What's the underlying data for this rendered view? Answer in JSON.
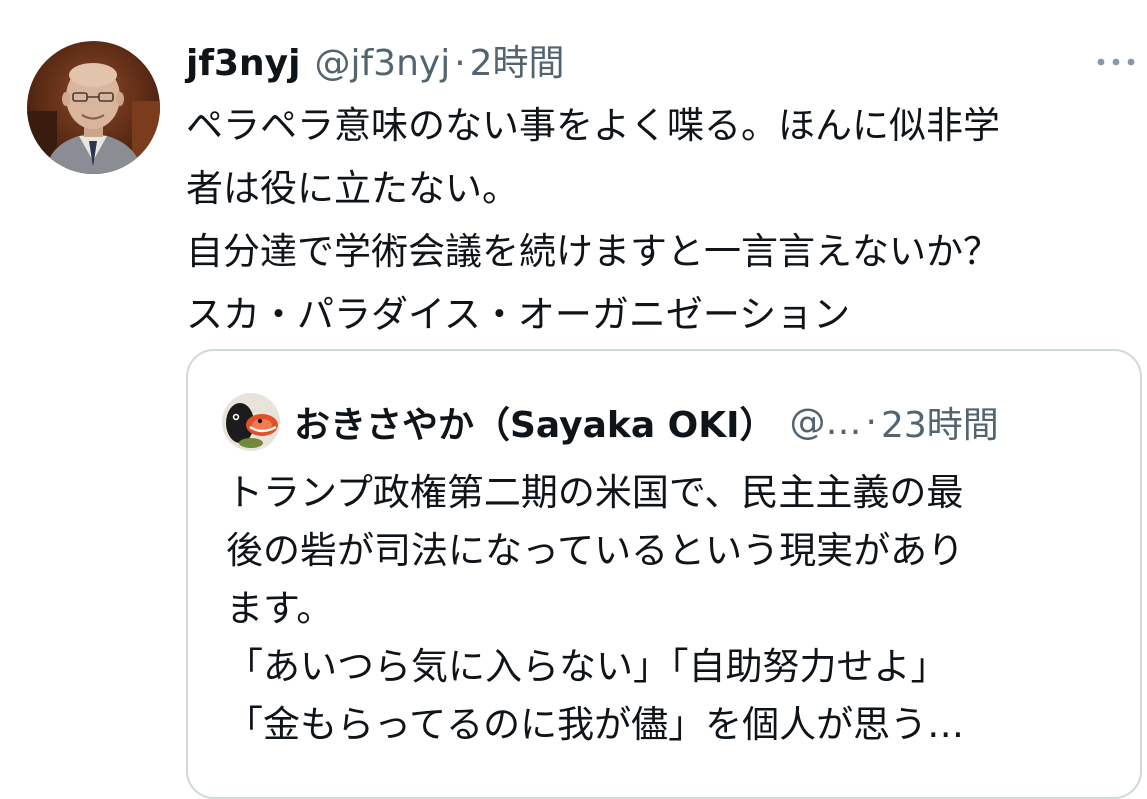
{
  "tweet": {
    "display_name": "jf3nyj",
    "handle": "@jf3nyj",
    "separator": "·",
    "timestamp": "2時間",
    "more_icon": "more-horizontal-icon",
    "avatar_icon": "user-photo-avatar",
    "body_lines": [
      "ペラペラ意味のない事をよく喋る。ほんに似非学",
      "者は役に立たない。",
      "自分達で学術会議を続けますと一言言えないか？",
      "スカ・パラダイス・オーガニゼーション"
    ]
  },
  "quote": {
    "display_name": "おきさやか（Sayaka OKI）",
    "handle": "@…",
    "separator": "·",
    "timestamp": "23時間",
    "avatar_icon": "bird-mascot-avatar",
    "body_lines": [
      "トランプ政権第二期の米国で、民主主義の最",
      "後の砦が司法になっているという現実があり",
      "ます。",
      "「あいつら気に入らない」「自助努力せよ」",
      "「金もらってるのに我が儘」を個人が思う…"
    ]
  },
  "colors": {
    "text_primary": "#0f1419",
    "text_secondary": "#536471",
    "border": "#cfd9de",
    "background": "#ffffff"
  }
}
